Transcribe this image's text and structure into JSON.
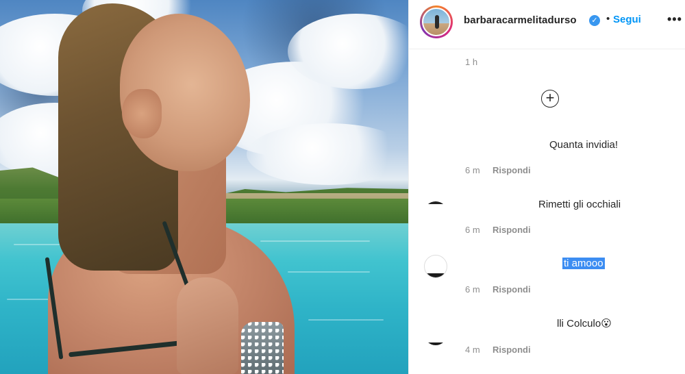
{
  "header": {
    "username": "barbaracarmelitadurso",
    "separator": "•",
    "follow_label": "Segui",
    "more_glyph": "•••",
    "verified_glyph": "✓"
  },
  "icons": {
    "plus_glyph": "+"
  },
  "comments": {
    "top_time": "1 h",
    "reply_label": "Rispondi",
    "items": [
      {
        "text": "Quanta invidia!",
        "time": "6 m"
      },
      {
        "text": "Rimetti gli occhiali",
        "time": "6 m"
      },
      {
        "text": "ti amooo",
        "time": "6 m"
      },
      {
        "text": "lli Colculo😮",
        "time": "4 m"
      }
    ]
  },
  "colors": {
    "link_blue": "#0095f6",
    "verified_blue": "#3897f0",
    "selection_blue": "#3c8df2",
    "muted_text": "#8e8e8e"
  }
}
